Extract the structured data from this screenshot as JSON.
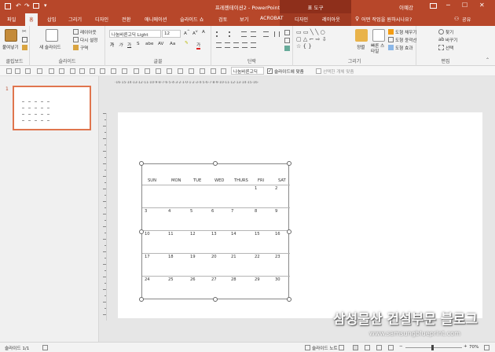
{
  "window": {
    "title": "프레젠테이션2 - PowerPoint",
    "context_tab": "표 도구",
    "user": "이예강",
    "controls": [
      "─",
      "☐",
      "✕"
    ]
  },
  "tabs": [
    {
      "label": "파일"
    },
    {
      "label": "홈",
      "active": true
    },
    {
      "label": "삽입"
    },
    {
      "label": "그리기"
    },
    {
      "label": "디자인"
    },
    {
      "label": "전환"
    },
    {
      "label": "애니메이션"
    },
    {
      "label": "슬라이드 쇼"
    },
    {
      "label": "검토"
    },
    {
      "label": "보기"
    },
    {
      "label": "ACROBAT"
    },
    {
      "label": "디자인"
    },
    {
      "label": "레이아웃"
    }
  ],
  "tell_me": "어떤 작업을 원하시나요?",
  "share_label": "공유",
  "ribbon": {
    "clipboard": {
      "paste": "붙여넣기",
      "label": "클립보드"
    },
    "slides": {
      "new_slide": "새 슬라이드",
      "layout": "레이아웃",
      "reset": "다시 설정",
      "section": "구역",
      "label": "슬라이드"
    },
    "font": {
      "name": "나눔바른고딕 Light",
      "size": "12",
      "label": "글꼴",
      "bold": "가",
      "underline": "가",
      "strike": "S",
      "case": "Aa",
      "font_color": "가"
    },
    "paragraph": {
      "label": "단락"
    },
    "drawing": {
      "arrange": "정렬",
      "quick_styles": "빠른 스타일",
      "fill": "도형 채우기",
      "outline": "도형 윤곽선",
      "effects": "도형 효과",
      "label": "그리기"
    },
    "editing": {
      "find": "찾기",
      "replace": "바꾸기",
      "select": "선택",
      "label": "편집"
    }
  },
  "toolbar2": {
    "font_name": "나눔바른고딕",
    "fit_slide": "슬라이드에 맞춤",
    "select_object": "선택한 개체 맞춤"
  },
  "ruler_text": "·16·15·14·13·12·11·10·9·8·7·6·5·4·3·2·1·0·1·2·3·4·5·6·7·8·9·10·11·12·13·14·15·16·",
  "thumb_number": "1",
  "calendar": {
    "headers": [
      "SUN",
      "MON",
      "TUE",
      "WED",
      "THURS",
      "FRI",
      "SAT"
    ],
    "rows": [
      [
        "",
        "",
        "",
        "",
        "",
        "1",
        "2"
      ],
      [
        "3",
        "4",
        "5",
        "6",
        "7",
        "8",
        "9"
      ],
      [
        "10",
        "11",
        "12",
        "13",
        "14",
        "15",
        "16"
      ],
      [
        "17",
        "18",
        "19",
        "20",
        "21",
        "22",
        "23"
      ],
      [
        "24",
        "25",
        "26",
        "27",
        "28",
        "29",
        "30"
      ]
    ]
  },
  "status": {
    "slide_count": "슬라이드 1/1",
    "notes": "슬라이드 노트",
    "zoom": "70%"
  },
  "watermark": {
    "title": "삼성물산 건설부문 블로그",
    "url": "www.samsungblueprint.com"
  },
  "colors": {
    "accent": "#b7472a",
    "context_tab": "#8e2f1b",
    "thumb_border": "#e0754e"
  }
}
